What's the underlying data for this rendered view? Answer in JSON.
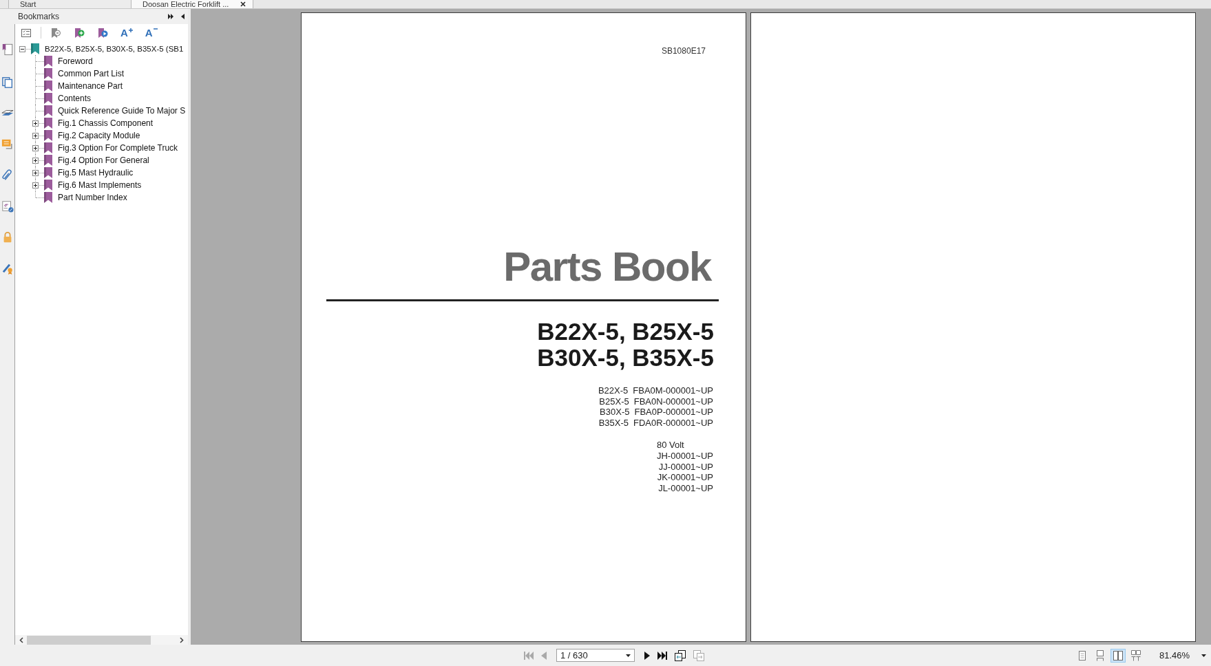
{
  "tabs": [
    {
      "label": "Start",
      "selected": false,
      "closable": false
    },
    {
      "label": "Doosan Electric Forklift ...",
      "selected": true,
      "closable": true
    }
  ],
  "bookmarks_panel": {
    "title": "Bookmarks",
    "text_size_buttons": [
      {
        "kind": "larger",
        "label": "A"
      },
      {
        "kind": "smaller",
        "label": "A"
      }
    ],
    "tree": [
      {
        "label": "B22X-5, B25X-5, B30X-5, B35X-5 (SB1",
        "expanded": true,
        "children": [
          {
            "label": "Foreword"
          },
          {
            "label": "Common Part List"
          },
          {
            "label": "Maintenance Part"
          },
          {
            "label": "Contents"
          },
          {
            "label": "Quick Reference Guide To Major S"
          },
          {
            "label": "Fig.1 Chassis Component",
            "expanded": false
          },
          {
            "label": "Fig.2 Capacity Module",
            "expanded": false
          },
          {
            "label": "Fig.3 Option For Complete Truck",
            "expanded": false
          },
          {
            "label": "Fig.4 Option For General",
            "expanded": false
          },
          {
            "label": "Fig.5 Mast Hydraulic",
            "expanded": false
          },
          {
            "label": "Fig.6 Mast Implements",
            "expanded": false
          },
          {
            "label": "Part Number Index"
          }
        ]
      }
    ]
  },
  "document": {
    "pages": [
      {
        "kind": "cover",
        "doc_code": "SB1080E17",
        "title": "Parts Book",
        "models": [
          "B22X-5, B25X-5",
          "B30X-5, B35X-5"
        ],
        "serials": [
          {
            "model": "B22X-5",
            "range": "FBA0M-000001~UP"
          },
          {
            "model": "B25X-5",
            "range": "FBA0N-000001~UP"
          },
          {
            "model": "B30X-5",
            "range": "FBA0P-000001~UP"
          },
          {
            "model": "B35X-5",
            "range": "FDA0R-000001~UP"
          }
        ],
        "voltage": {
          "label": "80 Volt",
          "ranges": [
            "JH-00001~UP",
            "JJ-00001~UP",
            "JK-00001~UP",
            "JL-00001~UP"
          ]
        }
      },
      {
        "kind": "blank"
      }
    ]
  },
  "status_bar": {
    "navigation": [
      {
        "kind": "first",
        "disabled": true
      },
      {
        "kind": "previous",
        "disabled": true
      },
      {
        "kind": "page_field",
        "value": "1 / 630"
      },
      {
        "kind": "next",
        "disabled": false
      },
      {
        "kind": "last",
        "disabled": false
      },
      {
        "kind": "view_back",
        "disabled": false
      },
      {
        "kind": "view_forward",
        "disabled": true
      }
    ],
    "view_modes": [
      {
        "kind": "single",
        "selected": false
      },
      {
        "kind": "continuous",
        "selected": false
      },
      {
        "kind": "facing",
        "selected": true
      },
      {
        "kind": "continuous_facing",
        "selected": false
      }
    ],
    "zoom": "81.46%"
  }
}
